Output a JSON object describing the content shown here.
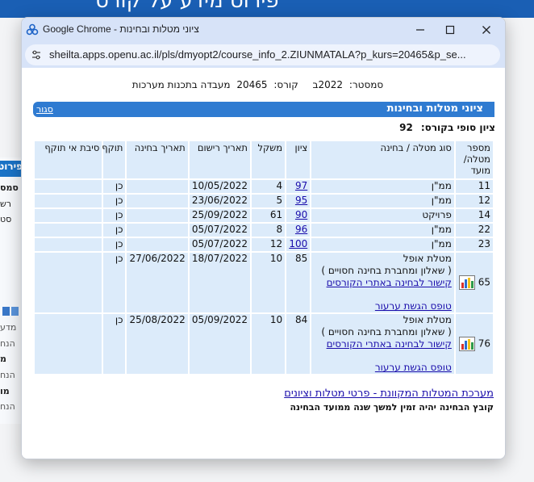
{
  "background": {
    "banner_text": "פירוט מידע על קורס",
    "side_tab": "פירוט",
    "side_items": [
      "סמס",
      "רש",
      "סט",
      "מדע",
      "הנח",
      "מ",
      "הנח",
      "מו",
      "הנ",
      "הנח"
    ]
  },
  "window": {
    "title": "Google Chrome - ציוני מטלות ובחינות",
    "url": "sheilta.apps.openu.ac.il/pls/dmyopt2/course_info_2.ZIUNMATALA?p_kurs=20465&p_se..."
  },
  "header": {
    "semester_label": "סמסטר:",
    "semester_value": "2022ב",
    "course_label": "קורס:",
    "course_value": "20465",
    "course_name": "מעבדה בתכנות מערכות"
  },
  "section": {
    "title": "ציוני מטלות ובחינות",
    "close": "סגור"
  },
  "final_grade": {
    "label": "ציון סופי בקורס:",
    "value": "92"
  },
  "table": {
    "headers": [
      "מספר מטלה/ מועד",
      "סוג מטלה / בחינה",
      "ציון",
      "משקל",
      "תאריך רישום",
      "תאריך בחינה",
      "תוקף",
      "סיבת אי תוקף"
    ],
    "rows": [
      {
        "num": "11",
        "type": "ממ\"ן",
        "grade": "97",
        "weight": "4",
        "reg_date": "10/05/2022",
        "exam_date": "",
        "valid": "כן",
        "reason": ""
      },
      {
        "num": "12",
        "type": "ממ\"ן",
        "grade": "95",
        "weight": "5",
        "reg_date": "23/06/2022",
        "exam_date": "",
        "valid": "כן",
        "reason": ""
      },
      {
        "num": "14",
        "type": "פרויקט",
        "grade": "90",
        "weight": "61",
        "reg_date": "25/09/2022",
        "exam_date": "",
        "valid": "כן",
        "reason": ""
      },
      {
        "num": "22",
        "type": "ממ\"ן",
        "grade": "96",
        "weight": "8",
        "reg_date": "05/07/2022",
        "exam_date": "",
        "valid": "כן",
        "reason": ""
      },
      {
        "num": "23",
        "type": "ממ\"ן",
        "grade": "100",
        "weight": "12",
        "reg_date": "05/07/2022",
        "exam_date": "",
        "valid": "כן",
        "reason": ""
      }
    ],
    "exam_rows": [
      {
        "num": "65",
        "type": "מטלת אופל",
        "sub": "( שאלון ומחברת בחינה חסויים )",
        "link1": "קישור לבחינה באתרי הקורסים",
        "link2": "טופס הגשת ערעור",
        "grade": "85",
        "weight": "10",
        "reg_date": "18/07/2022",
        "exam_date": "27/06/2022",
        "valid": "כן",
        "reason": ""
      },
      {
        "num": "76",
        "type": "מטלת אופל",
        "sub": "( שאלון ומחברת בחינה חסויים )",
        "link1": "קישור לבחינה באתרי הקורסים",
        "link2": "טופס הגשת ערעור",
        "grade": "84",
        "weight": "10",
        "reg_date": "05/09/2022",
        "exam_date": "25/08/2022",
        "valid": "כן",
        "reason": ""
      }
    ]
  },
  "footer": {
    "link": "מערכת המטלות המקוונת - פרטי מטלות וציונים",
    "note": "קובץ הבחינה יהיה זמין למשך שנה ממועד הבחינה"
  },
  "colors": {
    "header_blue": "#2f7bd1",
    "cell_bg": "#dcebfa",
    "link": "#1a0dab"
  }
}
